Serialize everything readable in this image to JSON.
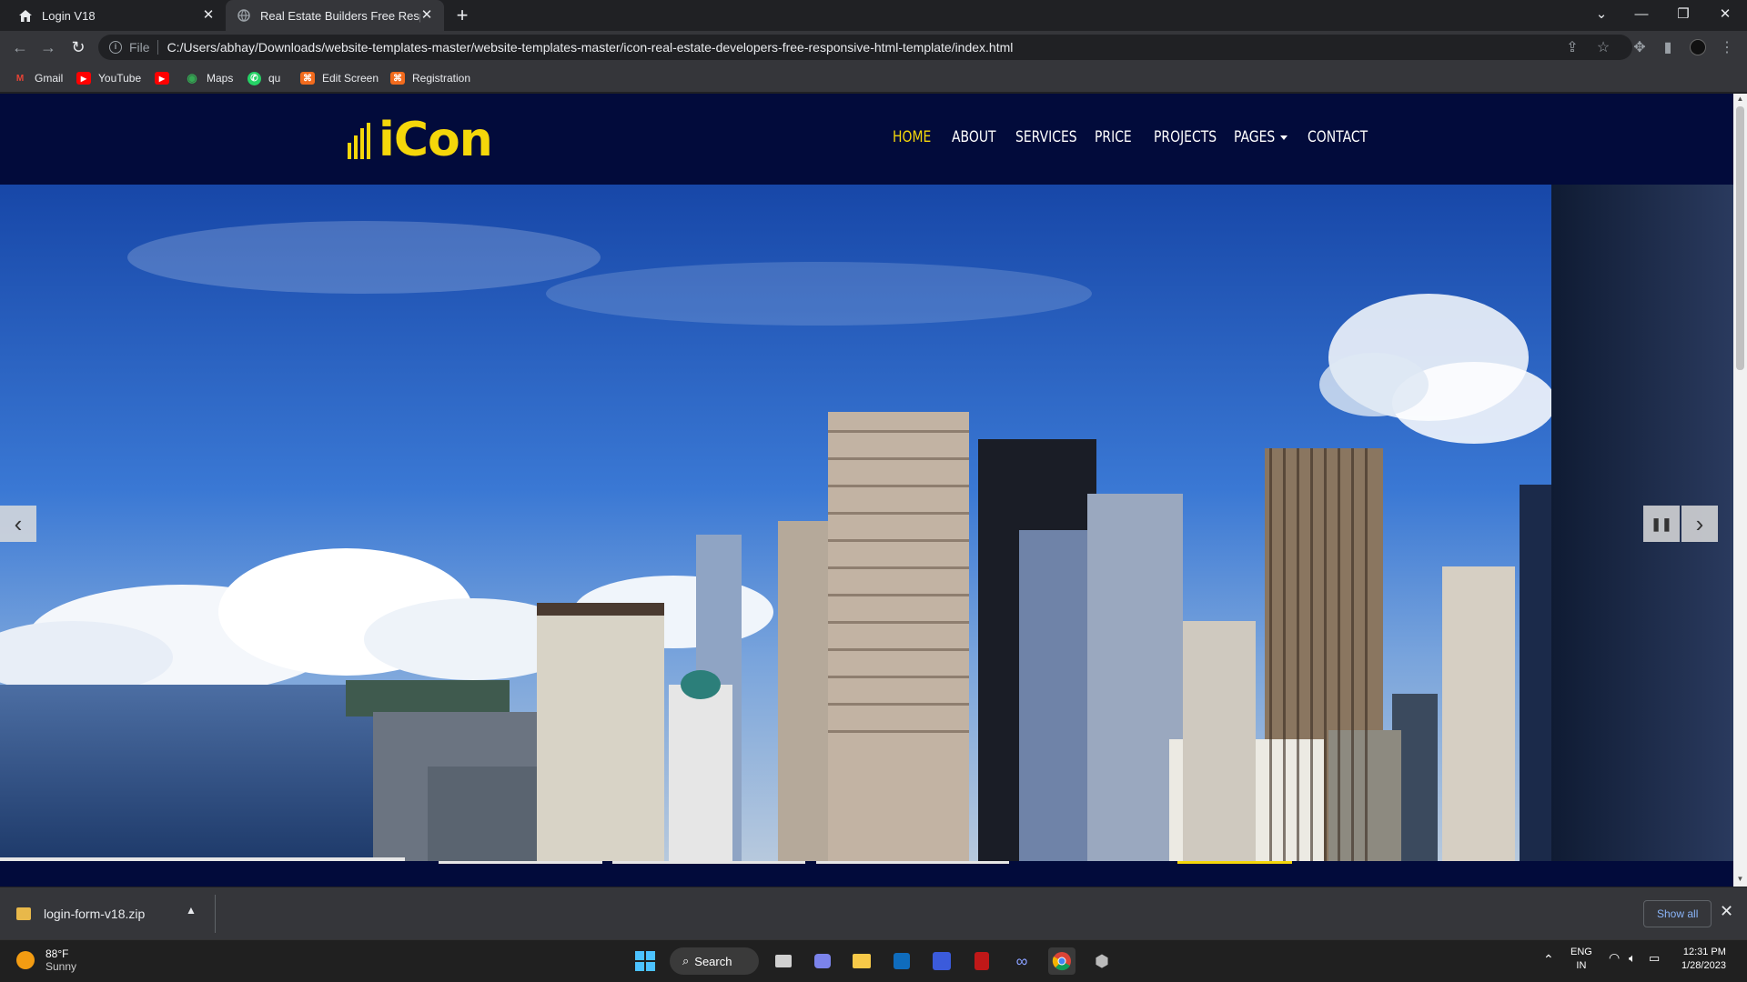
{
  "tabs": [
    {
      "label": "Login V18",
      "active": false
    },
    {
      "label": "Real Estate Builders Free Respons",
      "active": true
    }
  ],
  "address": {
    "scheme": "File",
    "url": "C:/Users/abhay/Downloads/website-templates-master/website-templates-master/icon-real-estate-developers-free-responsive-html-template/index.html"
  },
  "bookmarks": [
    {
      "label": "Gmail",
      "icon": "gmail-icon",
      "color": "#ea4335"
    },
    {
      "label": "YouTube",
      "icon": "youtube-icon",
      "color": "#ff0000"
    },
    {
      "label": "",
      "icon": "youtube-icon",
      "color": "#ff0000"
    },
    {
      "label": "Maps",
      "icon": "maps-icon",
      "color": "#34a853"
    },
    {
      "label": "qu",
      "icon": "whatsapp-icon",
      "color": "#25d366"
    },
    {
      "label": "Edit Screen",
      "icon": "bookmark-orange-icon",
      "color": "#f26b1d"
    },
    {
      "label": "Registration",
      "icon": "bookmark-orange-icon",
      "color": "#f26b1d"
    }
  ],
  "site": {
    "logo_text": "iCon",
    "menu": [
      {
        "label": "HOME",
        "active": true
      },
      {
        "label": "ABOUT",
        "active": false
      },
      {
        "label": "SERVICES",
        "active": false
      },
      {
        "label": "PRICE",
        "active": false
      },
      {
        "label": "PROJECTS",
        "active": false
      },
      {
        "label": "PAGES",
        "active": false,
        "dropdown": true
      },
      {
        "label": "CONTACT",
        "active": false
      }
    ],
    "colors": {
      "header_bg": "#020b3b",
      "accent": "#f5d70a"
    }
  },
  "download": {
    "filename": "login-form-v18.zip",
    "show_all": "Show all"
  },
  "taskbar": {
    "weather_temp": "88°F",
    "weather_desc": "Sunny",
    "search": "Search",
    "lang_top": "ENG",
    "lang_bottom": "IN",
    "time": "12:31 PM",
    "date": "1/28/2023"
  }
}
